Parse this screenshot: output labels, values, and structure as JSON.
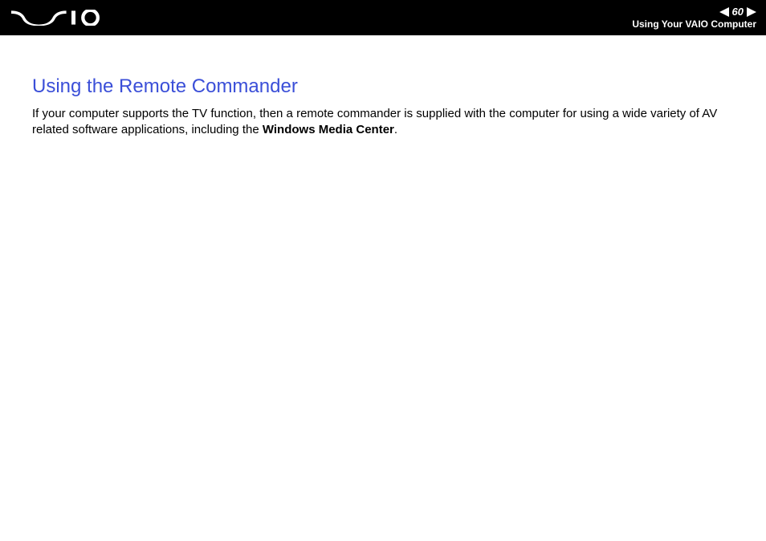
{
  "header": {
    "page_number": "60",
    "section": "Using Your VAIO Computer"
  },
  "content": {
    "heading": "Using the Remote Commander",
    "body_prefix": "If your computer supports the TV function, then a remote commander is supplied with the computer for using a wide variety of AV related software applications, including the ",
    "body_bold": "Windows Media Center",
    "body_suffix": "."
  }
}
